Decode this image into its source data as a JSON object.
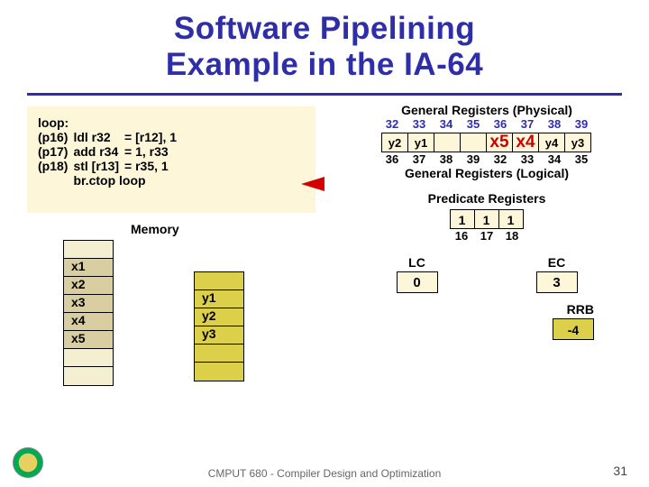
{
  "title_line1": "Software Pipelining",
  "title_line2": "Example in the IA-64",
  "code": {
    "label": "loop:",
    "rows": [
      {
        "pred": "(p16)",
        "op": "ldl r32",
        "rhs": "= [r12], 1"
      },
      {
        "pred": "(p17)",
        "op": "add r34",
        "rhs": "= 1, r33"
      },
      {
        "pred": "(p18)",
        "op": "stl [r13]",
        "rhs": "= r35, 1"
      },
      {
        "pred": "",
        "op": "br.ctop loop",
        "rhs": ""
      }
    ]
  },
  "memory_label": "Memory",
  "mem1": [
    "",
    "x1",
    "x2",
    "x3",
    "x4",
    "x5",
    "",
    ""
  ],
  "mem2": [
    "",
    "y1",
    "y2",
    "y3",
    "",
    ""
  ],
  "genreg": {
    "phys_title": "General Registers (Physical)",
    "phys_labels": [
      "32",
      "33",
      "34",
      "35",
      "36",
      "37",
      "38",
      "39"
    ],
    "values": [
      "y2",
      "y1",
      "",
      "",
      "x5",
      "x4",
      "y4",
      "y3"
    ],
    "log_labels": [
      "36",
      "37",
      "38",
      "39",
      "32",
      "33",
      "34",
      "35"
    ],
    "log_title": "General Registers (Logical)"
  },
  "predreg": {
    "title": "Predicate Registers",
    "values": [
      "1",
      "1",
      "1"
    ],
    "labels": [
      "16",
      "17",
      "18"
    ]
  },
  "counters": {
    "lc_label": "LC",
    "lc_value": "0",
    "ec_label": "EC",
    "ec_value": "3"
  },
  "rrb": {
    "label": "RRB",
    "value": "-4"
  },
  "footer": "CMPUT 680 - Compiler Design and Optimization",
  "pagenum": "31"
}
